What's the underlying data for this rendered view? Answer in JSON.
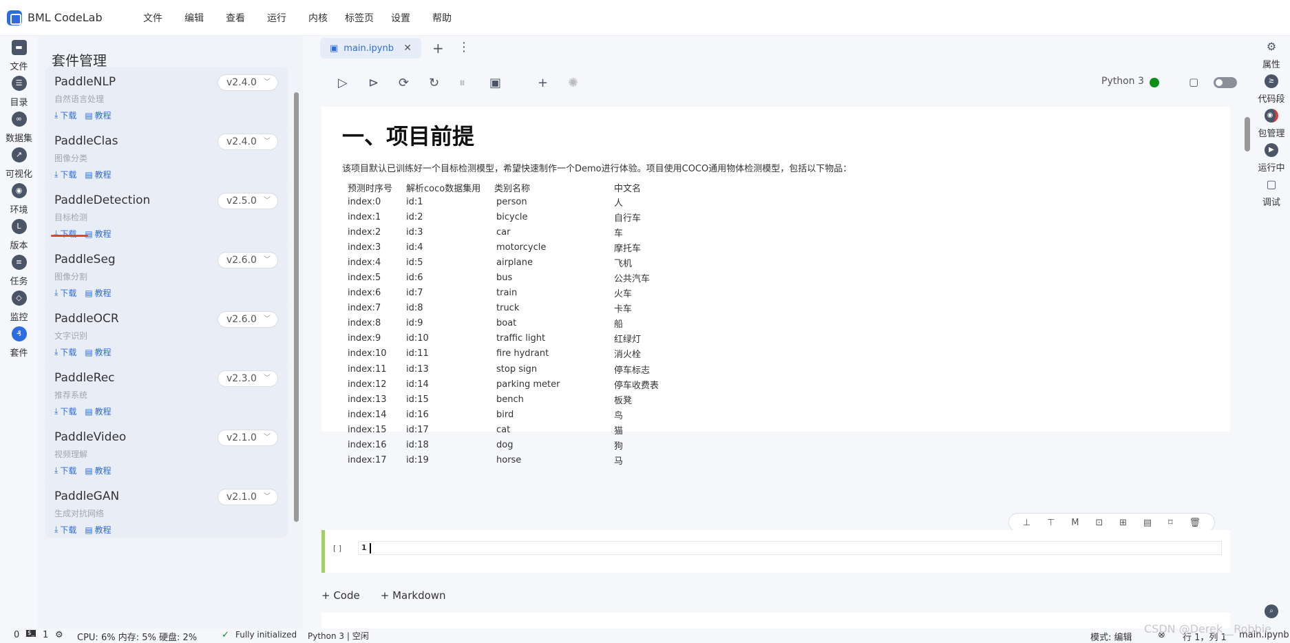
{
  "app": {
    "name": "BML CodeLab"
  },
  "menu": [
    "文件",
    "编辑",
    "查看",
    "运行",
    "内核",
    "标签页",
    "设置",
    "帮助"
  ],
  "leftnav": [
    "文件",
    "目录",
    "数据集",
    "可视化",
    "环境",
    "版本",
    "任务",
    "监控",
    "套件"
  ],
  "panel": {
    "title": "套件管理",
    "download_label": "下载",
    "tutorial_label": "教程",
    "packages": [
      {
        "name": "PaddleNLP",
        "desc": "自然语言处理",
        "version": "v2.4.0"
      },
      {
        "name": "PaddleClas",
        "desc": "图像分类",
        "version": "v2.4.0"
      },
      {
        "name": "PaddleDetection",
        "desc": "目标检测",
        "version": "v2.5.0"
      },
      {
        "name": "PaddleSeg",
        "desc": "图像分割",
        "version": "v2.6.0"
      },
      {
        "name": "PaddleOCR",
        "desc": "文字识别",
        "version": "v2.6.0"
      },
      {
        "name": "PaddleRec",
        "desc": "推荐系统",
        "version": "v2.3.0"
      },
      {
        "name": "PaddleVideo",
        "desc": "视频理解",
        "version": "v2.1.0"
      },
      {
        "name": "PaddleGAN",
        "desc": "生成对抗网络",
        "version": "v2.1.0"
      }
    ]
  },
  "tab": {
    "label": "main.ipynb"
  },
  "toolbar": {
    "kernel": "Python 3"
  },
  "notebook": {
    "md_title": "一、项目前提",
    "md_desc": "该项目默认已训练好一个目标检测模型，希望快速制作一个Demo进行体验。项目使用COCO通用物体检测模型，包括以下物品：",
    "table_headers": [
      "预测时序号",
      "解析coco数据集用",
      "类别名称",
      "中文名"
    ],
    "table_rows": [
      [
        "index:0",
        "id:1",
        "person",
        "人"
      ],
      [
        "index:1",
        "id:2",
        "bicycle",
        "自行车"
      ],
      [
        "index:2",
        "id:3",
        "car",
        "车"
      ],
      [
        "index:3",
        "id:4",
        "motorcycle",
        "摩托车"
      ],
      [
        "index:4",
        "id:5",
        "airplane",
        "飞机"
      ],
      [
        "index:5",
        "id:6",
        "bus",
        "公共汽车"
      ],
      [
        "index:6",
        "id:7",
        "train",
        "火车"
      ],
      [
        "index:7",
        "id:8",
        "truck",
        "卡车"
      ],
      [
        "index:8",
        "id:9",
        "boat",
        "船"
      ],
      [
        "index:9",
        "id:10",
        "traffic light",
        "红绿灯"
      ],
      [
        "index:10",
        "id:11",
        "fire hydrant",
        "消火栓"
      ],
      [
        "index:11",
        "id:13",
        "stop sign",
        "停车标志"
      ],
      [
        "index:12",
        "id:14",
        "parking meter",
        "停车收费表"
      ],
      [
        "index:13",
        "id:15",
        "bench",
        "板凳"
      ],
      [
        "index:14",
        "id:16",
        "bird",
        "鸟"
      ],
      [
        "index:15",
        "id:17",
        "cat",
        "猫"
      ],
      [
        "index:16",
        "id:18",
        "dog",
        "狗"
      ],
      [
        "index:17",
        "id:19",
        "horse",
        "马"
      ]
    ],
    "code_prompt": "[ ]",
    "code_line_no": "1",
    "add_code": "+ Code",
    "add_markdown": "+ Markdown"
  },
  "rightbar": [
    "属性",
    "代码段",
    "包管理",
    "运行中",
    "调试"
  ],
  "statusbar": {
    "terminals": "0",
    "kernels": "1",
    "resources": "CPU:  6% 内存:  5% 硬盘:  2%",
    "init": "Fully initialized",
    "kernel_status": "Python 3 | 空闲",
    "mode": "模式: 编辑",
    "position": "行 1，列 1",
    "file": "main.ipynb"
  },
  "watermark": "CSDN @Derek__Robbie"
}
